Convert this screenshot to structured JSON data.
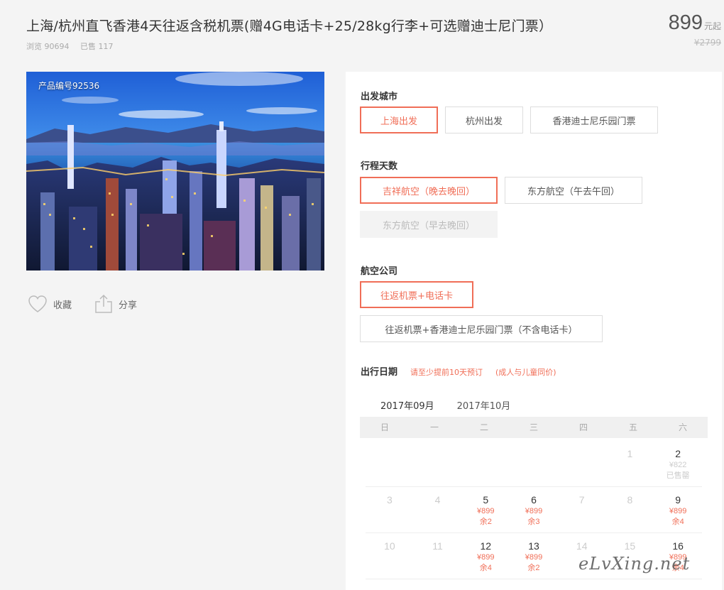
{
  "product": {
    "title": "上海/杭州直飞香港4天往返含税机票(赠4G电话卡+25/28kg行李+可选赠迪士尼门票）",
    "views": "浏览 90694",
    "sold": "已售 117",
    "price": "899",
    "price_unit": "元起",
    "old_price": "¥2799",
    "code": "产品编号92536"
  },
  "actions": {
    "favorite": "收藏",
    "share": "分享"
  },
  "departure": {
    "label": "出发城市",
    "options": [
      "上海出发",
      "杭州出发",
      "香港迪士尼乐园门票"
    ]
  },
  "days": {
    "label": "行程天数",
    "options": [
      "吉祥航空（晚去晚回）",
      "东方航空（午去午回）",
      "东方航空（早去晚回）"
    ]
  },
  "airline": {
    "label": "航空公司",
    "options": [
      "往返机票+电话卡",
      "往返机票+香港迪士尼乐园门票（不含电话卡）"
    ]
  },
  "date": {
    "label": "出行日期",
    "note1": "请至少提前10天预订",
    "note2": "(成人与儿童同价)",
    "months": [
      "2017年09月",
      "2017年10月"
    ],
    "weekdays": [
      "日",
      "一",
      "二",
      "三",
      "四",
      "五",
      "六"
    ],
    "weeks": [
      [
        {
          "day": ""
        },
        {
          "day": ""
        },
        {
          "day": ""
        },
        {
          "day": ""
        },
        {
          "day": ""
        },
        {
          "day": "1",
          "state": "past"
        },
        {
          "day": "2",
          "state": "soldout",
          "price": "¥822",
          "rem": "已售罄"
        }
      ],
      [
        {
          "day": "3",
          "state": "past"
        },
        {
          "day": "4",
          "state": "past"
        },
        {
          "day": "5",
          "state": "avail",
          "price": "¥899",
          "rem": "余2"
        },
        {
          "day": "6",
          "state": "avail",
          "price": "¥899",
          "rem": "余3"
        },
        {
          "day": "7",
          "state": "past"
        },
        {
          "day": "8",
          "state": "past"
        },
        {
          "day": "9",
          "state": "avail",
          "price": "¥899",
          "rem": "余4"
        }
      ],
      [
        {
          "day": "10",
          "state": "past"
        },
        {
          "day": "11",
          "state": "past"
        },
        {
          "day": "12",
          "state": "avail",
          "price": "¥899",
          "rem": "余4"
        },
        {
          "day": "13",
          "state": "avail",
          "price": "¥899",
          "rem": "余2"
        },
        {
          "day": "14",
          "state": "past"
        },
        {
          "day": "15",
          "state": "past"
        },
        {
          "day": "16",
          "state": "avail",
          "price": "¥899",
          "rem": "余4"
        }
      ]
    ]
  },
  "watermark": "eLvXing.net",
  "colors": {
    "accent": "#f06e57"
  }
}
